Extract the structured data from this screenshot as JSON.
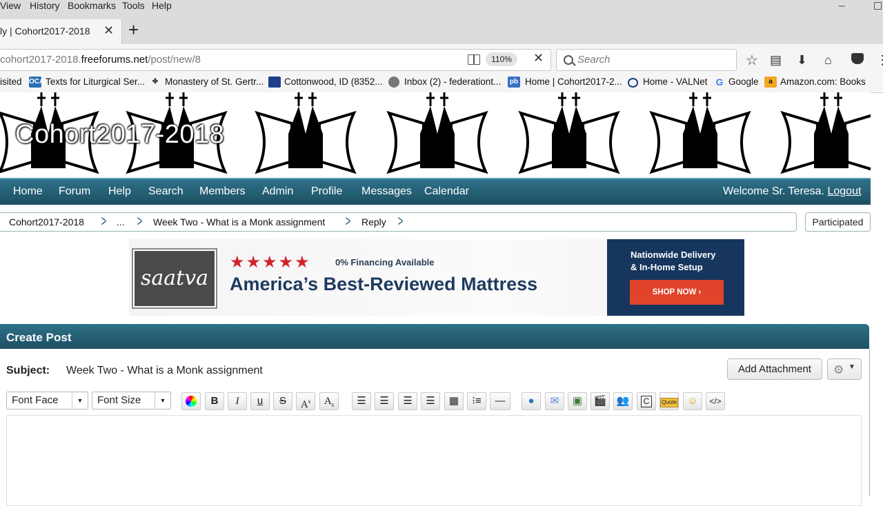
{
  "browser": {
    "menu": [
      "View",
      "History",
      "Bookmarks",
      "Tools",
      "Help"
    ],
    "tab_title": "ly | Cohort2017-2018",
    "url_prefix": "cohort2017-2018.",
    "url_domain": "freeforums.net",
    "url_path": "/post/new/8",
    "zoom": "110%",
    "search_placeholder": "Search",
    "bookmarks": [
      "isited",
      "Texts for Liturgical Ser...",
      "Monastery of St. Gertr...",
      "Cottonwood, ID (8352...",
      "Inbox (2) - federationt...",
      "Home | Cohort2017-2...",
      "Home - VALNet",
      "Google",
      "Amazon.com: Books"
    ]
  },
  "forum": {
    "site_title": "Cohort2017-2018",
    "nav": [
      "Home",
      "Forum",
      "Help",
      "Search",
      "Members",
      "Admin",
      "Profile",
      "Messages",
      "Calendar"
    ],
    "welcome": "Welcome Sr. Teresa.",
    "logout": "Logout",
    "breadcrumb": [
      "Cohort2017-2018",
      "...",
      "Week Two - What is a Monk assignment",
      "Reply"
    ],
    "participated": "Participated"
  },
  "ad": {
    "logo": "saatva",
    "stars": "★★★★★",
    "financing": "0% Financing Available",
    "headline": "America’s Best-Reviewed Mattress",
    "delivery_line1": "Nationwide Delivery",
    "delivery_line2": "& In-Home Setup",
    "cta": "SHOP NOW ›"
  },
  "create_post": {
    "title": "Create Post",
    "subject_label": "Subject:",
    "subject_value": "Week Two - What is a Monk assignment",
    "add_attachment": "Add Attachment",
    "font_face": "Font Face",
    "font_size": "Font Size",
    "toolbar": {
      "bold": "B",
      "italic": "I",
      "underline": "u",
      "strike": "S",
      "superscript": "A",
      "superscript_mark": "s",
      "subscript": "A",
      "subscript_mark": "s",
      "quote": "Quote",
      "code_c": "C",
      "source": "</>"
    }
  }
}
